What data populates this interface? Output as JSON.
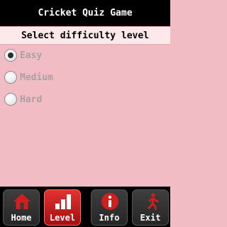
{
  "app": {
    "title": "Cricket Quiz Game"
  },
  "section": {
    "header": "Select difficulty level"
  },
  "difficulty": {
    "selected": "Easy",
    "options": [
      {
        "label": "Easy"
      },
      {
        "label": "Medium"
      },
      {
        "label": "Hard"
      }
    ]
  },
  "bottom_nav": {
    "items": [
      {
        "label": "Home",
        "icon": "home-icon"
      },
      {
        "label": "Level",
        "icon": "bar-chart-icon"
      },
      {
        "label": "Info",
        "icon": "info-icon"
      },
      {
        "label": "Exit",
        "icon": "running-man-icon"
      }
    ],
    "active": "Level"
  },
  "colors": {
    "background": "#f2bcc4",
    "header_band": "#fde9ec",
    "accent_red": "#d11f1f",
    "bar_black": "#000000"
  }
}
